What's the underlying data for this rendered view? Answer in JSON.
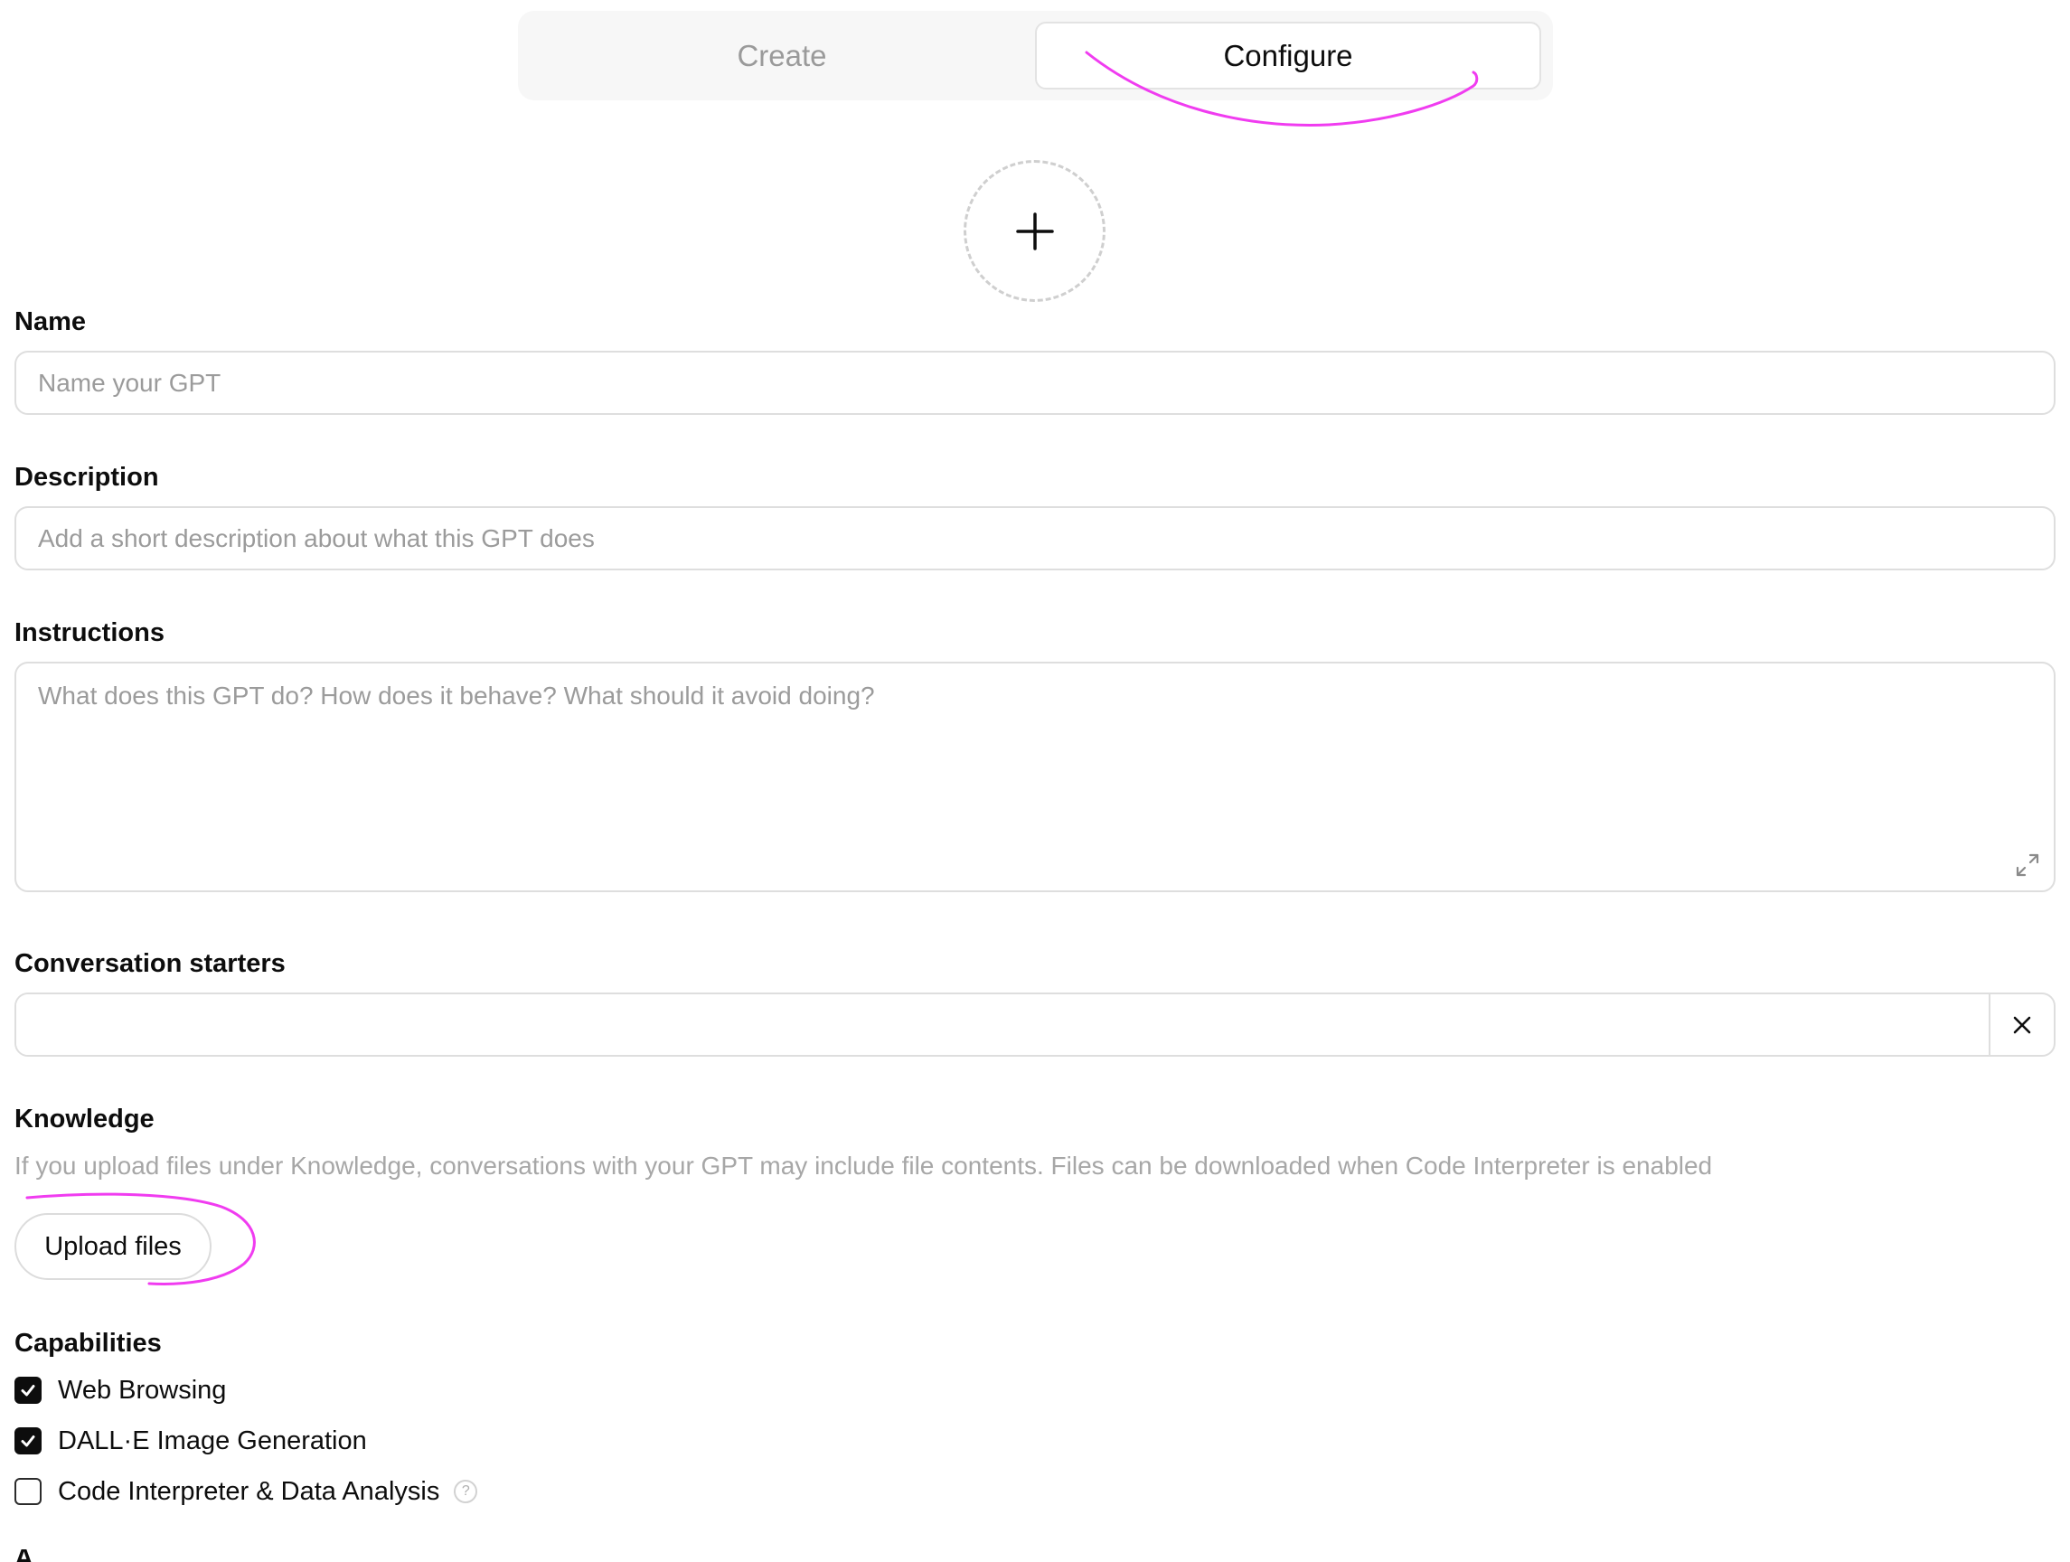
{
  "tabs": {
    "create": "Create",
    "configure": "Configure",
    "active": "configure"
  },
  "avatar": {
    "icon": "plus-icon"
  },
  "name": {
    "label": "Name",
    "placeholder": "Name your GPT",
    "value": ""
  },
  "description": {
    "label": "Description",
    "placeholder": "Add a short description about what this GPT does",
    "value": ""
  },
  "instructions": {
    "label": "Instructions",
    "placeholder": "What does this GPT do? How does it behave? What should it avoid doing?",
    "value": "",
    "expand_icon": "expand-icon"
  },
  "conversation_starters": {
    "label": "Conversation starters",
    "items": [
      ""
    ],
    "remove_icon": "close-icon"
  },
  "knowledge": {
    "label": "Knowledge",
    "hint": "If you upload files under Knowledge, conversations with your GPT may include file contents. Files can be downloaded when Code Interpreter is enabled",
    "upload_label": "Upload files"
  },
  "capabilities": {
    "label": "Capabilities",
    "items": [
      {
        "label": "Web Browsing",
        "checked": true
      },
      {
        "label": "DALL·E Image Generation",
        "checked": true
      },
      {
        "label": "Code Interpreter & Data Analysis",
        "checked": false,
        "help": "?"
      }
    ]
  },
  "annotation_color": "#f03cf0"
}
